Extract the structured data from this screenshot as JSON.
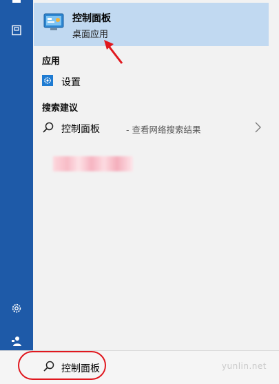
{
  "best_match": {
    "title": "控制面板",
    "subtitle": "桌面应用",
    "icon": "control-panel-icon"
  },
  "sections": {
    "apps": "应用",
    "suggestions": "搜索建议"
  },
  "apps": [
    {
      "label": "设置",
      "icon": "gear-icon"
    }
  ],
  "suggestions": [
    {
      "query": "控制面板",
      "hint": "- 查看网络搜索结果",
      "icon": "search-icon"
    }
  ],
  "search": {
    "value": "控制面板"
  },
  "watermark": "yunlin.net",
  "rail_icons": [
    "home-icon",
    "notebook-icon",
    "settings-icon",
    "feedback-icon"
  ],
  "colors": {
    "rail": "#1e5aa8",
    "selected": "#c1d9f1",
    "annotation": "#e0181f",
    "accent": "#1e7bd2"
  }
}
